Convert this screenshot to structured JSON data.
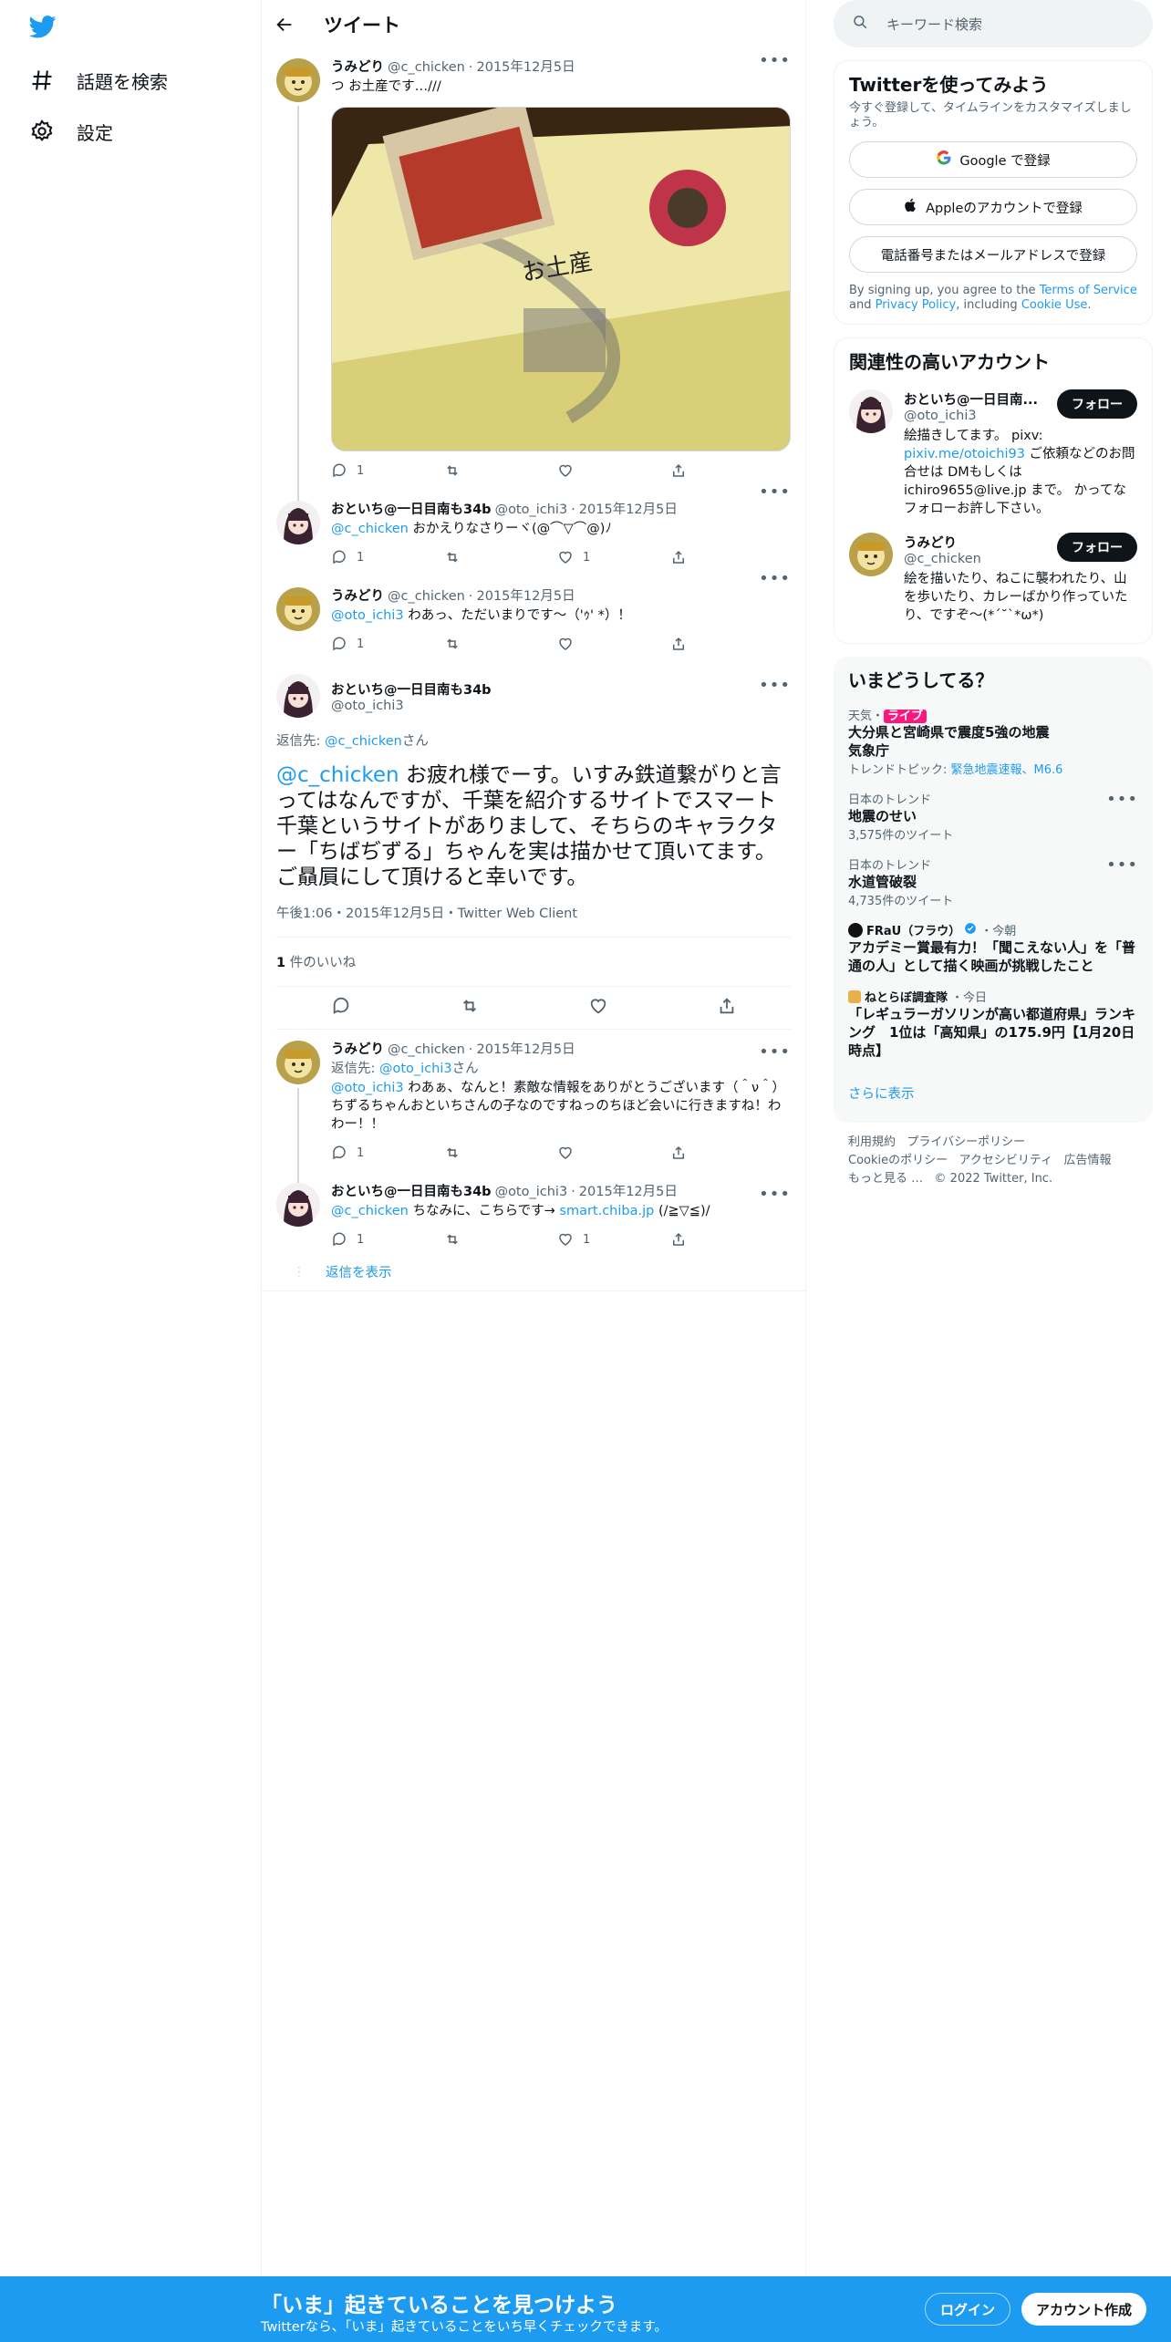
{
  "nav": {
    "explore_label": "話題を検索",
    "settings_label": "設定"
  },
  "header": {
    "title": "ツイート"
  },
  "thread": [
    {
      "name": "うみどり",
      "handle": "@c_chicken",
      "date": "2015年12月5日",
      "text": "つ お土産です…///",
      "replies": "1",
      "likes": ""
    },
    {
      "name": "おといち@一日目南も34b",
      "handle": "@oto_ichi3",
      "date": "2015年12月5日",
      "mention": "@c_chicken",
      "text": " おかえりなさりーヾ(@⌒▽⌒@)ﾉ",
      "replies": "1",
      "likes": "1"
    },
    {
      "name": "うみどり",
      "handle": "@c_chicken",
      "date": "2015年12月5日",
      "mention": "@oto_ichi3",
      "text": " わあっ、ただいまりです〜（'ｩ' *）！",
      "replies": "1",
      "likes": ""
    }
  ],
  "focal": {
    "name": "おといち@一日目南も34b",
    "handle": "@oto_ichi3",
    "reply_to_prefix": "返信先: ",
    "reply_to_handle": "@c_chicken",
    "reply_to_suffix": "さん",
    "mention": "@c_chicken",
    "text": " お疲れ様でーす。いすみ鉄道繋がりと言ってはなんですが、千葉を紹介するサイトでスマート千葉というサイトがありまして、そちらのキャラクター「ちばぢずる」ちゃんを実は描かせて頂いてます。ご贔屓にして頂けると幸いです。",
    "meta": "午後1:06・2015年12月5日・Twitter Web Client",
    "likes_count": "1",
    "likes_label": " 件のいいね"
  },
  "replies": [
    {
      "name": "うみどり",
      "handle": "@c_chicken",
      "date": "2015年12月5日",
      "reply_to_prefix": "返信先: ",
      "reply_to_handle": "@oto_ichi3",
      "reply_to_suffix": "さん",
      "mention": "@oto_ichi3",
      "text": " わあぁ、なんと！素敵な情報をありがとうございます（＾ν＾）ちずるちゃんおといちさんの子なのですねっのちほど会いに行きますね！わわー！！",
      "replies": "1",
      "likes": ""
    },
    {
      "name": "おといち@一日目南も34b",
      "handle": "@oto_ichi3",
      "date": "2015年12月5日",
      "mention": "@c_chicken",
      "text": " ちなみに、こちらです→ ",
      "link": "smart.chiba.jp",
      "text2": " (/≧▽≦)/",
      "replies": "1",
      "likes": "1"
    }
  ],
  "show_replies": "返信を表示",
  "right": {
    "search_placeholder": "キーワード検索",
    "signup_title": "Twitterを使ってみよう",
    "signup_sub": "今すぐ登録して、タイムラインをカスタマイズしましょう。",
    "google_btn": "Google で登録",
    "apple_btn": "Appleのアカウントで登録",
    "phone_btn": "電話番号またはメールアドレスで登録",
    "terms_prefix": "By signing up, you agree to the ",
    "terms_link": "Terms of Service",
    "terms_and": " and ",
    "privacy_link": "Privacy Policy",
    "terms_mid": ", including ",
    "cookie_link": "Cookie Use",
    "terms_end": ".",
    "related_title": "関連性の高いアカウント",
    "accounts": [
      {
        "name": "おといち@一日目南...",
        "handle": "@oto_ichi3",
        "follow": "フォロー",
        "bio_a": "絵描きしてます。 pixv: ",
        "bio_link": "pixiv.me/otoichi93",
        "bio_b": " ご依頼などのお問合せは DMもしくは ichiro9655@live.jp まで。 かってなフォローお許し下さい。"
      },
      {
        "name": "うみどり",
        "handle": "@c_chicken",
        "follow": "フォロー",
        "bio_a": "絵を描いたり、ねこに襲われたり、山を歩いたり、カレーばかり作っていたり、ですぞ〜(*´˘`*ω*)",
        "bio_link": "",
        "bio_b": ""
      }
    ],
    "trends_title": "いまどうしてる？",
    "trends": [
      {
        "ctx": "天気・",
        "live": "ライブ",
        "title": "大分県と宮崎県で震度5強の地震",
        "sub": "気象庁",
        "topic_prefix": "トレンドトピック: ",
        "topic_link": "緊急地震速報、M6.6"
      },
      {
        "ctx": "日本のトレンド",
        "title": "地震のせい",
        "count": "3,575件のツイート"
      },
      {
        "ctx": "日本のトレンド",
        "title": "水道管破裂",
        "count": "4,735件のツイート"
      },
      {
        "ctx": "FRaU（フラウ）",
        "time": "・今朝",
        "title": "アカデミー賞最有力！「聞こえない人」を「普通の人」として描く映画が挑戦したこと"
      },
      {
        "ctx": "ねとらぼ調査隊",
        "time": "・今日",
        "title": "「レギュラーガソリンが高い都道府県」ランキング　1位は「高知県」の175.9円【1月20日時点】"
      }
    ],
    "show_more": "さらに表示",
    "footer": [
      "利用規約",
      "プライバシーポリシー",
      "Cookieのポリシー",
      "アクセシビリティ",
      "広告情報",
      "もっと見る …",
      "© 2022 Twitter, Inc."
    ]
  },
  "bottom": {
    "headline": "「いま」起きていることを見つけよう",
    "sub": "Twitterなら、「いま」起きていることをいち早くチェックできます。",
    "login": "ログイン",
    "signup": "アカウント作成"
  }
}
